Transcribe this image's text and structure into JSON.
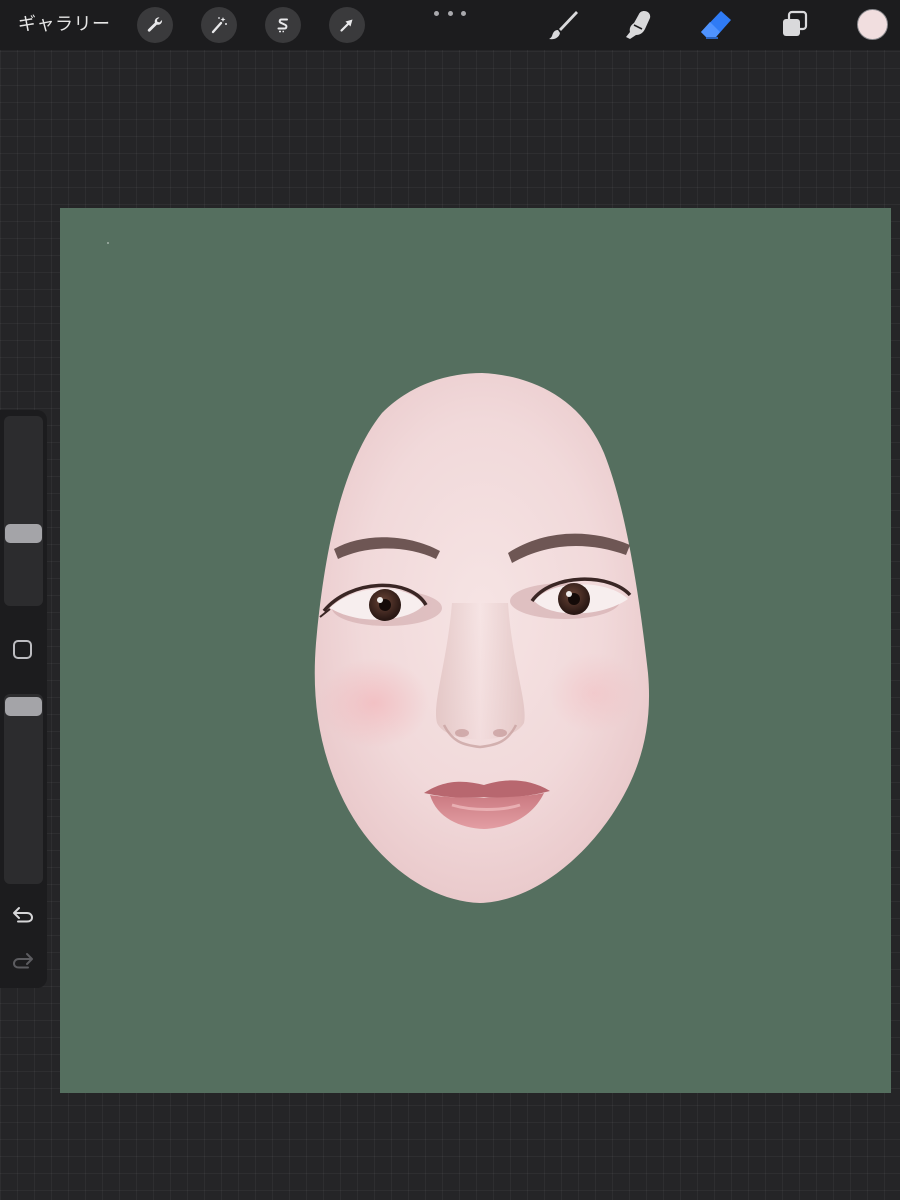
{
  "toolbar": {
    "gallery_label": "ギャラリー",
    "left_tools": [
      {
        "name": "actions-wrench-icon"
      },
      {
        "name": "adjustments-wand-icon"
      },
      {
        "name": "selection-lasso-icon"
      },
      {
        "name": "transform-arrow-icon"
      }
    ],
    "more_icon": "ellipsis-icon",
    "right_tools": [
      {
        "name": "brush-icon",
        "active": false
      },
      {
        "name": "smudge-icon",
        "active": false
      },
      {
        "name": "eraser-icon",
        "active": true
      },
      {
        "name": "layers-icon",
        "active": false
      }
    ],
    "current_color": "#f1dedf"
  },
  "canvas": {
    "background_color": "#556f5f",
    "content": "face-cutout-photo"
  },
  "sidebar": {
    "brush_size_level": 0.62,
    "opacity_level": 0.05,
    "modify_button_icon": "eyedropper-square-icon",
    "undo_icon": "undo-icon",
    "redo_icon": "redo-icon",
    "redo_enabled": false
  },
  "colors": {
    "toolbar_bg": "#1c1c1e",
    "workspace_bg": "#252527",
    "active_tool": "#2f7bf5",
    "icon": "#d9d9db"
  }
}
